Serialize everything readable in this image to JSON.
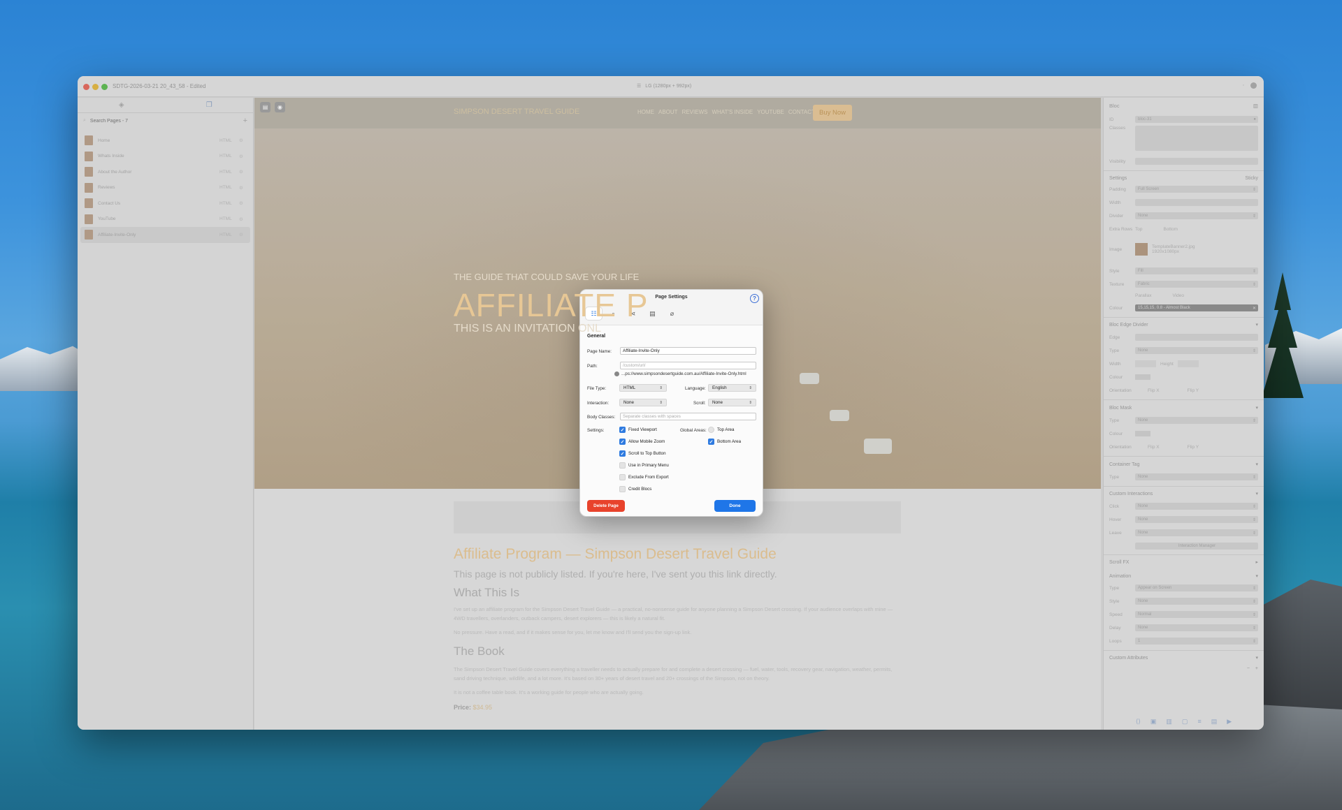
{
  "window": {
    "document_title": "SDTG-2026-03-21 20_43_58 - Edited",
    "viewport_label": "LG (1280px + 992px)"
  },
  "sidebar": {
    "search_placeholder": "Search Pages - 7",
    "pages": [
      {
        "name": "Home",
        "type": "HTML"
      },
      {
        "name": "Whats Inside",
        "type": "HTML"
      },
      {
        "name": "About the Author",
        "type": "HTML"
      },
      {
        "name": "Reviews",
        "type": "HTML"
      },
      {
        "name": "Contact Us",
        "type": "HTML"
      },
      {
        "name": "YouTube",
        "type": "HTML"
      },
      {
        "name": "Affiliate-Invite-Only",
        "type": "HTML"
      }
    ]
  },
  "site": {
    "brand": "SIMPSON DESERT TRAVEL GUIDE",
    "nav": [
      "HOME",
      "ABOUT",
      "REVIEWS",
      "WHAT'S INSIDE",
      "YOUTUBE",
      "CONTACT"
    ],
    "buy_button": "Buy Now",
    "hero_kicker": "THE GUIDE THAT COULD SAVE YOUR LIFE",
    "hero_title": "AFFILIATE P",
    "hero_sub": "THIS IS AN INVITATION ONL",
    "content_h1": "Affiliate Program — Simpson Desert Travel Guide",
    "content_lead": "This page is not publicly listed. If you're here, I've sent you this link directly.",
    "content_h2": "What This Is",
    "p1": "I've set up an affiliate program for the Simpson Desert Travel Guide — a practical, no-nonsense guide for anyone planning a Simpson Desert crossing. If your audience overlaps with mine — 4WD travellers, overlanders, outback campers, desert explorers — this is likely a natural fit.",
    "p2": "No pressure. Have a read, and if it makes sense for you, let me know and I'll send you the sign-up link.",
    "content_h3": "The Book",
    "p3": "The Simpson Desert Travel Guide covers everything a traveller needs to actually prepare for and complete a desert crossing — fuel, water, tools, recovery gear, navigation, weather, permits, sand driving technique, wildlife, and a lot more. It's based on 30+ years of desert travel and 20+ crossings of the Simpson, not on theory.",
    "p4": "It is not a coffee table book. It's a working guide for people who are actually going.",
    "price_label": "Price:",
    "price_value": "$34.95"
  },
  "inspector": {
    "header": "Bloc",
    "id_label": "ID",
    "id_value": "bloc-31",
    "classes_label": "Classes",
    "visibility_label": "Visibility",
    "settings_label": "Settings",
    "sticky_label": "Sticky",
    "padding_label": "Padding",
    "padding_value": "Full Screen",
    "width_label": "Width",
    "divider_label": "Divider",
    "divider_value": "None",
    "extra_rows_label": "Extra Rows",
    "top_label": "Top",
    "bottom_label": "Bottom",
    "image_label": "Image",
    "image_name": "TemplateBanner2.jpg",
    "image_size": "1920x1080px",
    "style_label": "Style",
    "style_value": "Fill",
    "texture_label": "Texture",
    "texture_value": "Fabric",
    "parallax_label": "Parallax",
    "video_label": "Video",
    "colour_label": "Colour",
    "colour_value": "15,15,15, 0.8 - Almost Black",
    "edge_section": "Bloc Edge Divider",
    "edge_label": "Edge",
    "type_label": "Type",
    "type_none": "None",
    "height_label": "Height",
    "orientation_label": "Orientation",
    "flip_x": "Flip X",
    "flip_y": "Flip Y",
    "mask_section": "Bloc Mask",
    "container_section": "Container Tag",
    "interactions_section": "Custom Interactions",
    "click_label": "Click",
    "hover_label": "Hover",
    "leave_label": "Leave",
    "interaction_manager": "Interaction Manager",
    "scrollfx_section": "Scroll FX",
    "animation_section": "Animation",
    "anim_type_value": "Appear on Screen",
    "speed_label": "Speed",
    "speed_value": "Normal",
    "delay_label": "Delay",
    "loops_label": "Loops",
    "loops_value": "1",
    "attrs_section": "Custom Attributes"
  },
  "dialog": {
    "title": "Page Settings",
    "section": "General",
    "page_name_label": "Page Name:",
    "page_name_value": "Affiliate-Invite-Only",
    "path_label": "Path:",
    "path_placeholder": "/custom/url/",
    "url": "...ps://www.simpsondesertguide.com.au/Affiliate-Invite-Only.html",
    "file_type_label": "File Type:",
    "file_type_value": "HTML",
    "language_label": "Language:",
    "language_value": "English",
    "interaction_label": "Interaction:",
    "interaction_value": "None",
    "scroll_label": "Scroll:",
    "scroll_value": "None",
    "body_classes_label": "Body Classes:",
    "body_classes_placeholder": "Separate classes with spaces",
    "settings_label": "Settings:",
    "global_areas_label": "Global Areas:",
    "opt_fixed_viewport": "Fixed Viewport",
    "opt_mobile_zoom": "Allow Mobile Zoom",
    "opt_scroll_top": "Scroll to Top Button",
    "opt_primary_menu": "Use in Primary Menu",
    "opt_exclude_export": "Exclude From Export",
    "opt_credit_blocs": "Credit Blocs",
    "area_top": "Top Area",
    "area_bottom": "Bottom Area",
    "delete_button": "Delete Page",
    "done_button": "Done"
  }
}
